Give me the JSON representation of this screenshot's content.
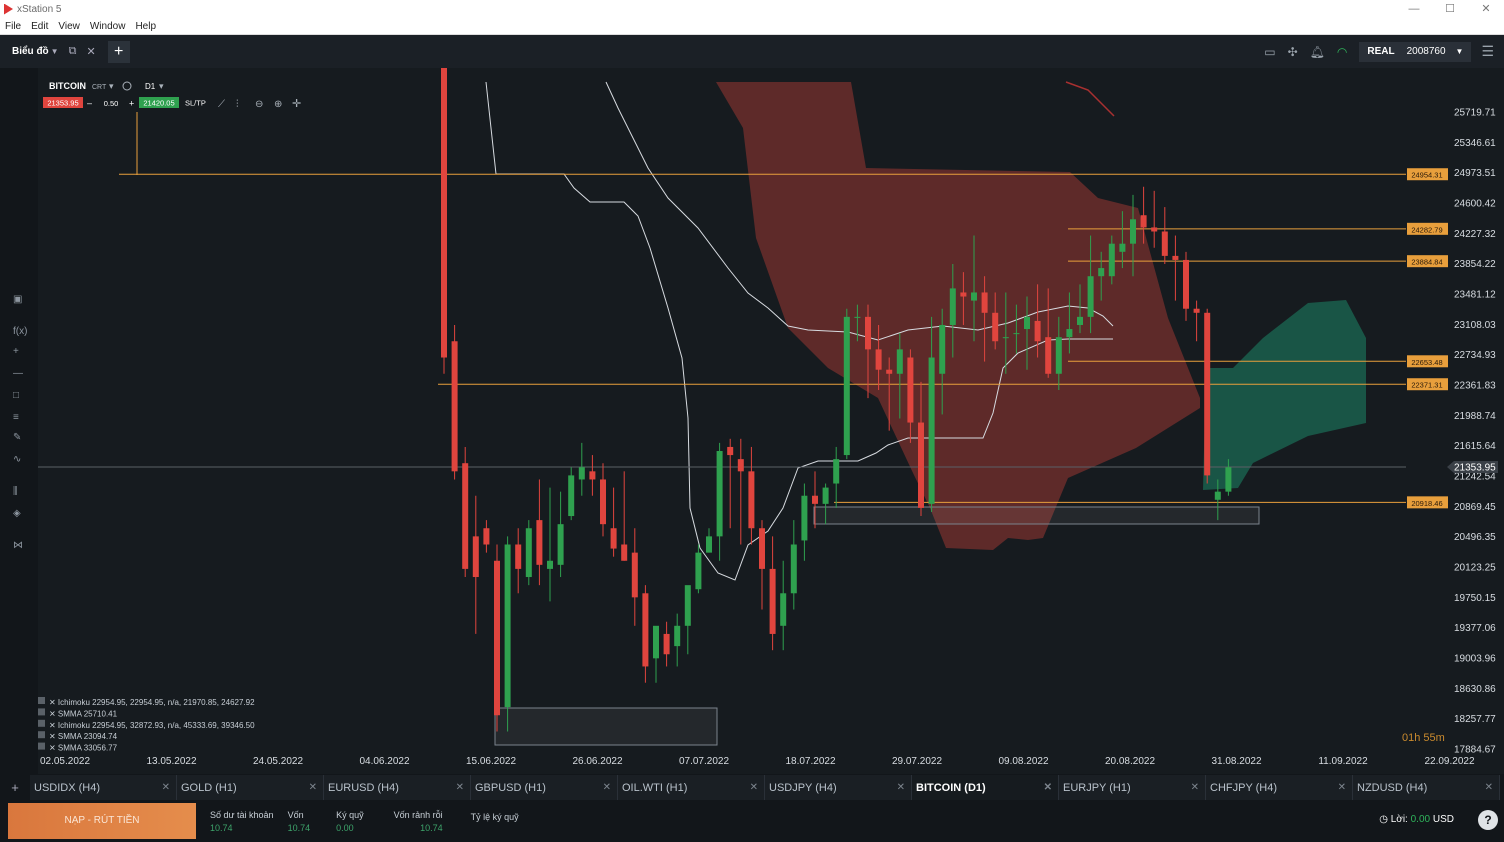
{
  "window": {
    "title": "xStation 5"
  },
  "menu": [
    "File",
    "Edit",
    "View",
    "Window",
    "Help"
  ],
  "toolbar": {
    "tab_name": "Biểu đồ",
    "account_type": "REAL",
    "account_number": "2008760"
  },
  "instrument": {
    "name": "BITCOIN",
    "extra": "CRT",
    "timeframe": "D1",
    "sell_price": "21353.95",
    "volume": "0.50",
    "buy_price": "21420.05",
    "sltp_label": "SL/TP"
  },
  "legend": [
    "Ichimoku 22954.95, 22954.95, n/a, 21970.85, 24627.92",
    "SMMA 25710.41",
    "Ichimoku 22954.95, 32872.93, n/a, 45333.69, 39346.50",
    "SMMA 23094.74",
    "SMMA 33056.77"
  ],
  "chart_data": {
    "type": "candlestick",
    "y_ticks": [
      "25719.71",
      "25346.61",
      "24973.51",
      "24600.42",
      "24227.32",
      "23854.22",
      "23481.12",
      "23108.03",
      "22734.93",
      "22361.83",
      "21988.74",
      "21615.64",
      "21242.54",
      "20869.45",
      "20496.35",
      "20123.25",
      "19750.15",
      "19377.06",
      "19003.96",
      "18630.86",
      "18257.77",
      "17884.67"
    ],
    "x_ticks": [
      "02.05.2022",
      "13.05.2022",
      "24.05.2022",
      "04.06.2022",
      "15.06.2022",
      "26.06.2022",
      "07.07.2022",
      "18.07.2022",
      "29.07.2022",
      "09.08.2022",
      "20.08.2022",
      "31.08.2022",
      "11.09.2022",
      "22.09.2022"
    ],
    "current_price": "21353.95",
    "level_labels": [
      {
        "label": "24954.31",
        "value": 24954.31
      },
      {
        "label": "24282.79",
        "value": 24282.79
      },
      {
        "label": "23884.84",
        "value": 23884.84
      },
      {
        "label": "22653.48",
        "value": 22653.48
      },
      {
        "label": "22371.31",
        "value": 22371.31
      },
      {
        "label": "20918.46",
        "value": 20918.46
      }
    ],
    "countdown": "01h 55m",
    "candles": [
      [
        26400,
        26400,
        22500,
        22700
      ],
      [
        22900,
        23100,
        21200,
        21300
      ],
      [
        21400,
        21600,
        20000,
        20100
      ],
      [
        20500,
        21000,
        19300,
        20000
      ],
      [
        20600,
        20700,
        20300,
        20400
      ],
      [
        20200,
        20400,
        18100,
        18300
      ],
      [
        18400,
        20500,
        18100,
        20400
      ],
      [
        20400,
        20600,
        19800,
        20100
      ],
      [
        20000,
        20700,
        19900,
        20600
      ],
      [
        20700,
        21200,
        19900,
        20150
      ],
      [
        20100,
        21100,
        19700,
        20200
      ],
      [
        20150,
        21050,
        20000,
        20650
      ],
      [
        20750,
        21350,
        20700,
        21250
      ],
      [
        21200,
        21650,
        21000,
        21350
      ],
      [
        21300,
        21500,
        21000,
        21200
      ],
      [
        21200,
        21400,
        20500,
        20650
      ],
      [
        20600,
        21100,
        20250,
        20350
      ],
      [
        20400,
        21300,
        20200,
        20200
      ],
      [
        20300,
        20600,
        19400,
        19750
      ],
      [
        19800,
        19900,
        18700,
        18900
      ],
      [
        19000,
        19300,
        18700,
        19400
      ],
      [
        19300,
        19450,
        18900,
        19050
      ],
      [
        19150,
        19550,
        18900,
        19400
      ],
      [
        19400,
        19850,
        19050,
        19900
      ],
      [
        19850,
        20400,
        19800,
        20300
      ],
      [
        20300,
        20600,
        20300,
        20500
      ],
      [
        20500,
        21650,
        20200,
        21550
      ],
      [
        21600,
        21700,
        20600,
        21500
      ],
      [
        21450,
        21700,
        20400,
        21300
      ],
      [
        21300,
        21600,
        20400,
        20600
      ],
      [
        20600,
        20700,
        19600,
        20100
      ],
      [
        20100,
        20500,
        19100,
        19300
      ],
      [
        19400,
        20200,
        19100,
        19800
      ],
      [
        19800,
        20700,
        19600,
        20400
      ],
      [
        20450,
        21150,
        20200,
        21000
      ],
      [
        21000,
        21300,
        20600,
        20900
      ],
      [
        20900,
        21150,
        20650,
        21100
      ],
      [
        21150,
        21600,
        20850,
        21450
      ],
      [
        21500,
        23300,
        21450,
        23200
      ],
      [
        23200,
        23350,
        22900,
        23200
      ],
      [
        23200,
        23350,
        22200,
        22800
      ],
      [
        22800,
        23100,
        22300,
        22550
      ],
      [
        22550,
        22700,
        21800,
        22500
      ],
      [
        22500,
        23000,
        21950,
        22800
      ],
      [
        22700,
        22800,
        21650,
        21900
      ],
      [
        21900,
        22400,
        20750,
        20850
      ],
      [
        20900,
        23200,
        20800,
        22700
      ],
      [
        22500,
        23300,
        22000,
        23100
      ],
      [
        23100,
        23850,
        22700,
        23550
      ],
      [
        23500,
        23750,
        23100,
        23450
      ],
      [
        23400,
        24200,
        22900,
        23500
      ],
      [
        23500,
        23700,
        22650,
        23250
      ],
      [
        23250,
        23500,
        22800,
        22900
      ],
      [
        22950,
        23500,
        22500,
        22950
      ],
      [
        23000,
        23350,
        22750,
        23000
      ],
      [
        23050,
        23450,
        22550,
        23200
      ],
      [
        23150,
        23600,
        22700,
        22900
      ],
      [
        22950,
        23550,
        22450,
        22500
      ],
      [
        22500,
        23200,
        22300,
        22950
      ],
      [
        22950,
        23500,
        22750,
        23050
      ],
      [
        23100,
        23600,
        23000,
        23200
      ],
      [
        23200,
        24200,
        23000,
        23700
      ],
      [
        23700,
        24000,
        23400,
        23800
      ],
      [
        23700,
        24200,
        23600,
        24100
      ],
      [
        24000,
        24500,
        23800,
        24100
      ],
      [
        24100,
        24700,
        23700,
        24400
      ],
      [
        24450,
        24800,
        24100,
        24300
      ],
      [
        24300,
        24750,
        24050,
        24250
      ],
      [
        24250,
        24550,
        23850,
        23950
      ],
      [
        23950,
        24200,
        23400,
        23900
      ],
      [
        23900,
        24000,
        23150,
        23300
      ],
      [
        23300,
        23400,
        22900,
        23250
      ],
      [
        23250,
        23300,
        21150,
        21250
      ],
      [
        20950,
        21200,
        20700,
        21050
      ],
      [
        21050,
        21450,
        21000,
        21350
      ]
    ]
  },
  "tabs": [
    {
      "label": "USDIDX (H4)"
    },
    {
      "label": "GOLD (H1)"
    },
    {
      "label": "EURUSD (H4)"
    },
    {
      "label": "GBPUSD (H1)"
    },
    {
      "label": "OIL.WTI (H1)"
    },
    {
      "label": "USDJPY (H4)"
    },
    {
      "label": "BITCOIN (D1)"
    },
    {
      "label": "EURJPY (H1)"
    },
    {
      "label": "CHFJPY (H4)"
    },
    {
      "label": "NZDUSD (H4)"
    }
  ],
  "bottom": {
    "deposit_label": "NẠP - RÚT TIỀN",
    "balance_label": "Số dư tài khoản",
    "balance_value": "10.74",
    "capital_label": "Vốn",
    "capital_value": "10.74",
    "margin_label": "Ký quỹ",
    "margin_value": "0.00",
    "free_label": "Vốn rảnh rỗi",
    "free_value": "10.74",
    "margin_level_label": "Tỷ lệ ký quỹ",
    "profit_label": "Lời:",
    "profit_value": "0.00",
    "currency": "USD"
  },
  "colors": {
    "bull": "#2fa14f",
    "bear": "#e0453e",
    "level": "#e89f3c",
    "cloud_bear": "#6b2d2b",
    "cloud_bull": "#1a5c4a"
  }
}
